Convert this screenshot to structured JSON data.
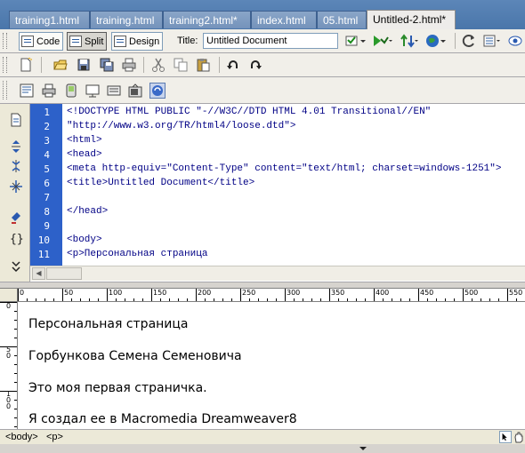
{
  "tabs": [
    {
      "label": "training1.html"
    },
    {
      "label": "training.html"
    },
    {
      "label": "training2.html*"
    },
    {
      "label": "index.html"
    },
    {
      "label": "05.html"
    },
    {
      "label": "Untitled-2.html*"
    }
  ],
  "doc_toolbar": {
    "code_label": "Code",
    "split_label": "Split",
    "design_label": "Design",
    "title_label": "Title:",
    "title_value": "Untitled Document"
  },
  "code": {
    "line_numbers": [
      "1",
      "2",
      "3",
      "4",
      "5",
      "6",
      "7",
      "8",
      "9",
      "10",
      "11"
    ],
    "lines": [
      "<!DOCTYPE HTML PUBLIC \"-//W3C//DTD HTML 4.01 Transitional//EN\"",
      "\"http://www.w3.org/TR/html4/loose.dtd\">",
      "<html>",
      "<head>",
      "<meta http-equiv=\"Content-Type\" content=\"text/html; charset=windows-1251\">",
      "<title>Untitled Document</title>",
      "",
      "</head>",
      "",
      "<body>",
      "<p>Персональная страница"
    ]
  },
  "ruler": {
    "h_labels": [
      "0",
      "50",
      "100",
      "150",
      "200",
      "250",
      "300",
      "350",
      "400",
      "450",
      "500",
      "550"
    ],
    "v_labels": [
      "0",
      "50",
      "100"
    ]
  },
  "design": {
    "paragraphs": [
      "Персональная страница",
      "Горбункова Семена Семеновича",
      "Это моя первая страничка.",
      "Я создал ее в Macromedia Dreamweaver8"
    ]
  },
  "status": {
    "tag_body": "<body>",
    "tag_p": "<p>"
  },
  "colors": {
    "gutter": "#2d61c9",
    "code_text": "#000085",
    "tab_bar": "#4a76aa"
  }
}
